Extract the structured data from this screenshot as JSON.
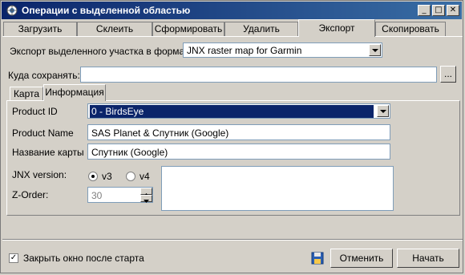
{
  "window": {
    "title": "Операции с выделенной областью",
    "close_symbol": "✕",
    "minimize_symbol": "_",
    "maximize_symbol": "□"
  },
  "tabs": [
    "Загрузить",
    "Склеить",
    "Сформировать",
    "Удалить",
    "Экспорт",
    "Скопировать"
  ],
  "export": {
    "format_label": "Экспорт выделенного участка в формат",
    "format_value": "JNX raster map for Garmin",
    "save_label": "Куда сохранять:",
    "save_value": "",
    "browse_label": "..."
  },
  "subtabs": [
    "Карта",
    "Информация"
  ],
  "info": {
    "product_id_label": "Product ID",
    "product_id_value": "0 - BirdsEye",
    "product_name_label": "Product Name",
    "product_name_value": "SAS Planet & Спутник (Google)",
    "map_name_label": "Название карты",
    "map_name_value": "Спутник (Google)",
    "jnx_version_label": "JNX version:",
    "v3_label": "v3",
    "v4_label": "v4",
    "zorder_label": "Z-Order:",
    "zorder_value": "30"
  },
  "footer": {
    "close_after_start_label": "Закрыть окно после старта",
    "close_after_start_checked": true,
    "check_mark": "✓",
    "cancel_label": "Отменить",
    "start_label": "Начать"
  },
  "colors": {
    "titlebar_start": "#0a246a",
    "titlebar_end": "#3a6ea5",
    "selection": "#0a246a"
  }
}
